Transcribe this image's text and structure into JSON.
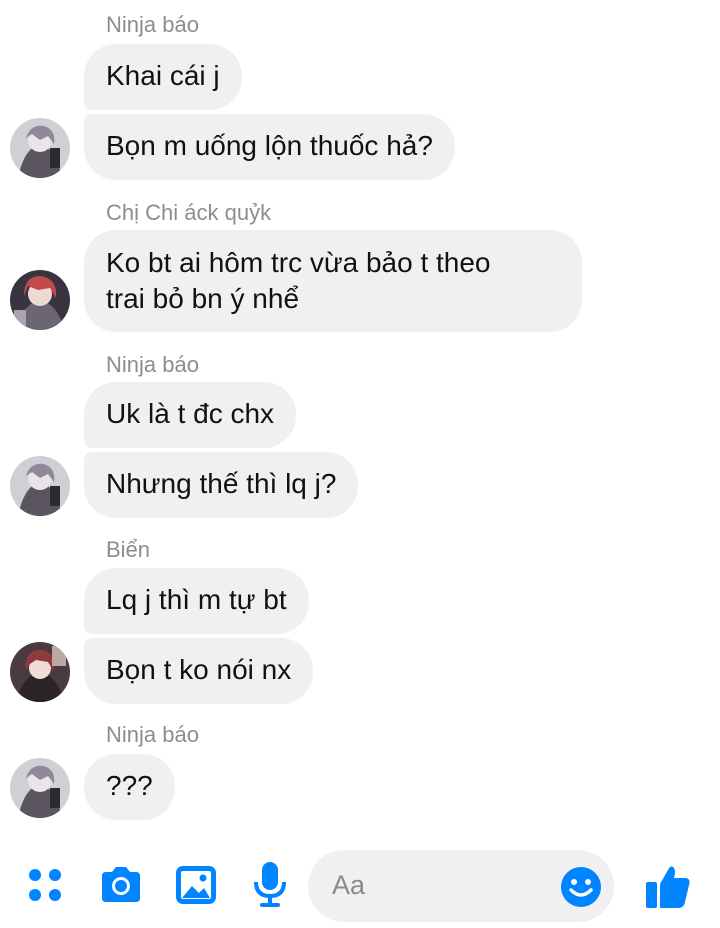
{
  "messages": [
    {
      "sender": "Ninja báo",
      "lines": [
        "Khai cái j",
        "Bọn m uống lộn thuốc hả?"
      ]
    },
    {
      "sender": "Chị Chi áck quỷk",
      "lines": [
        "Ko bt ai hôm trc vừa bảo t theo\ntrai bỏ bn ý nhể"
      ]
    },
    {
      "sender": "Ninja báo",
      "lines": [
        "Uk là t đc chx",
        "Nhưng thế thì lq j?"
      ]
    },
    {
      "sender": "Biển",
      "lines": [
        "Lq j thì m tự bt",
        "Bọn t ko nói nx"
      ]
    },
    {
      "sender": "Ninja báo",
      "lines": [
        "???"
      ]
    }
  ],
  "composer": {
    "placeholder": "Aa",
    "icons": [
      "apps-icon",
      "camera-icon",
      "image-icon",
      "microphone-icon",
      "emoji-icon",
      "like-icon"
    ],
    "accent": "#0084ff"
  }
}
